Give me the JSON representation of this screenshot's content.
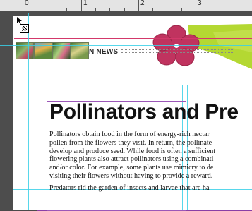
{
  "ruler": {
    "marks": [
      "0",
      "1",
      "2",
      "3"
    ]
  },
  "header": {
    "news_label": "N NEWS"
  },
  "article": {
    "title": "Pollinators and Pre",
    "lines": [
      "Pollinators obtain food in the form of energy-rich nectar",
      "pollen from the flowers they visit. In return, the pollinate",
      "develop and produce seed. While food is often a sufficient",
      "flowering plants also attract pollinators using a combinati",
      "and/or color. For example, some plants use mimicry to de",
      "visiting their flowers without having to provide a reward.",
      "Predators rid the garden of insects and larvae that are ha"
    ]
  },
  "colors": {
    "margin_guide": "#d3386a",
    "column_guide": "#39d0e8",
    "frame": "#8a3fa6",
    "flower": "#c0335f",
    "band": "#b4d832"
  },
  "icons": [
    "cursor-arrow-icon",
    "frame-marker-icon",
    "flower-graphic"
  ]
}
